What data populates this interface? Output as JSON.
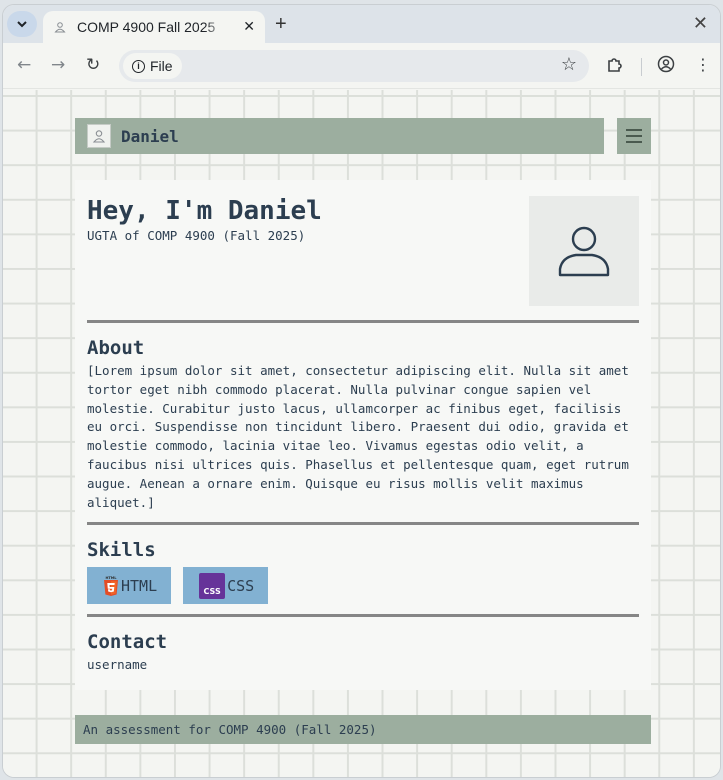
{
  "browser": {
    "tab_title": "COMP 4900 Fall 2025",
    "site_chip": "File",
    "icons": [
      "chevron-down-icon",
      "close-icon",
      "plus-icon",
      "back-icon",
      "forward-icon",
      "reload-icon",
      "info-icon",
      "star-icon",
      "extensions-icon",
      "profile-icon",
      "more-icon"
    ]
  },
  "header": {
    "site_name": "Daniel"
  },
  "hero": {
    "title": "Hey, I'm Daniel",
    "subtitle": "UGTA of COMP 4900 (Fall 2025)"
  },
  "about": {
    "heading": "About",
    "text": "[Lorem ipsum dolor sit amet, consectetur adipiscing elit. Nulla sit amet tortor eget nibh commodo placerat. Nulla pulvinar congue sapien vel molestie. Curabitur justo lacus, ullamcorper ac finibus eget, facilisis eu orci. Suspendisse non tincidunt libero. Praesent dui odio, gravida et molestie commodo, lacinia vitae leo. Vivamus egestas odio velit, a faucibus nisi ultrices quis. Phasellus et pellentesque quam, eget rutrum augue. Aenean a ornare enim. Quisque eu risus mollis velit maximus aliquet.]"
  },
  "skills": {
    "heading": "Skills",
    "items": [
      {
        "label": "HTML",
        "icon": "html5-icon"
      },
      {
        "label": "CSS",
        "icon": "css-icon",
        "logo_text": "CSS"
      }
    ]
  },
  "contact": {
    "heading": "Contact",
    "text": "username"
  },
  "footer": {
    "text": "An assessment for COMP 4900 (Fall 2025)"
  },
  "colors": {
    "header_bg": "#9cae9f",
    "skill_bg": "#82b1d2",
    "text": "#2c3e50"
  }
}
